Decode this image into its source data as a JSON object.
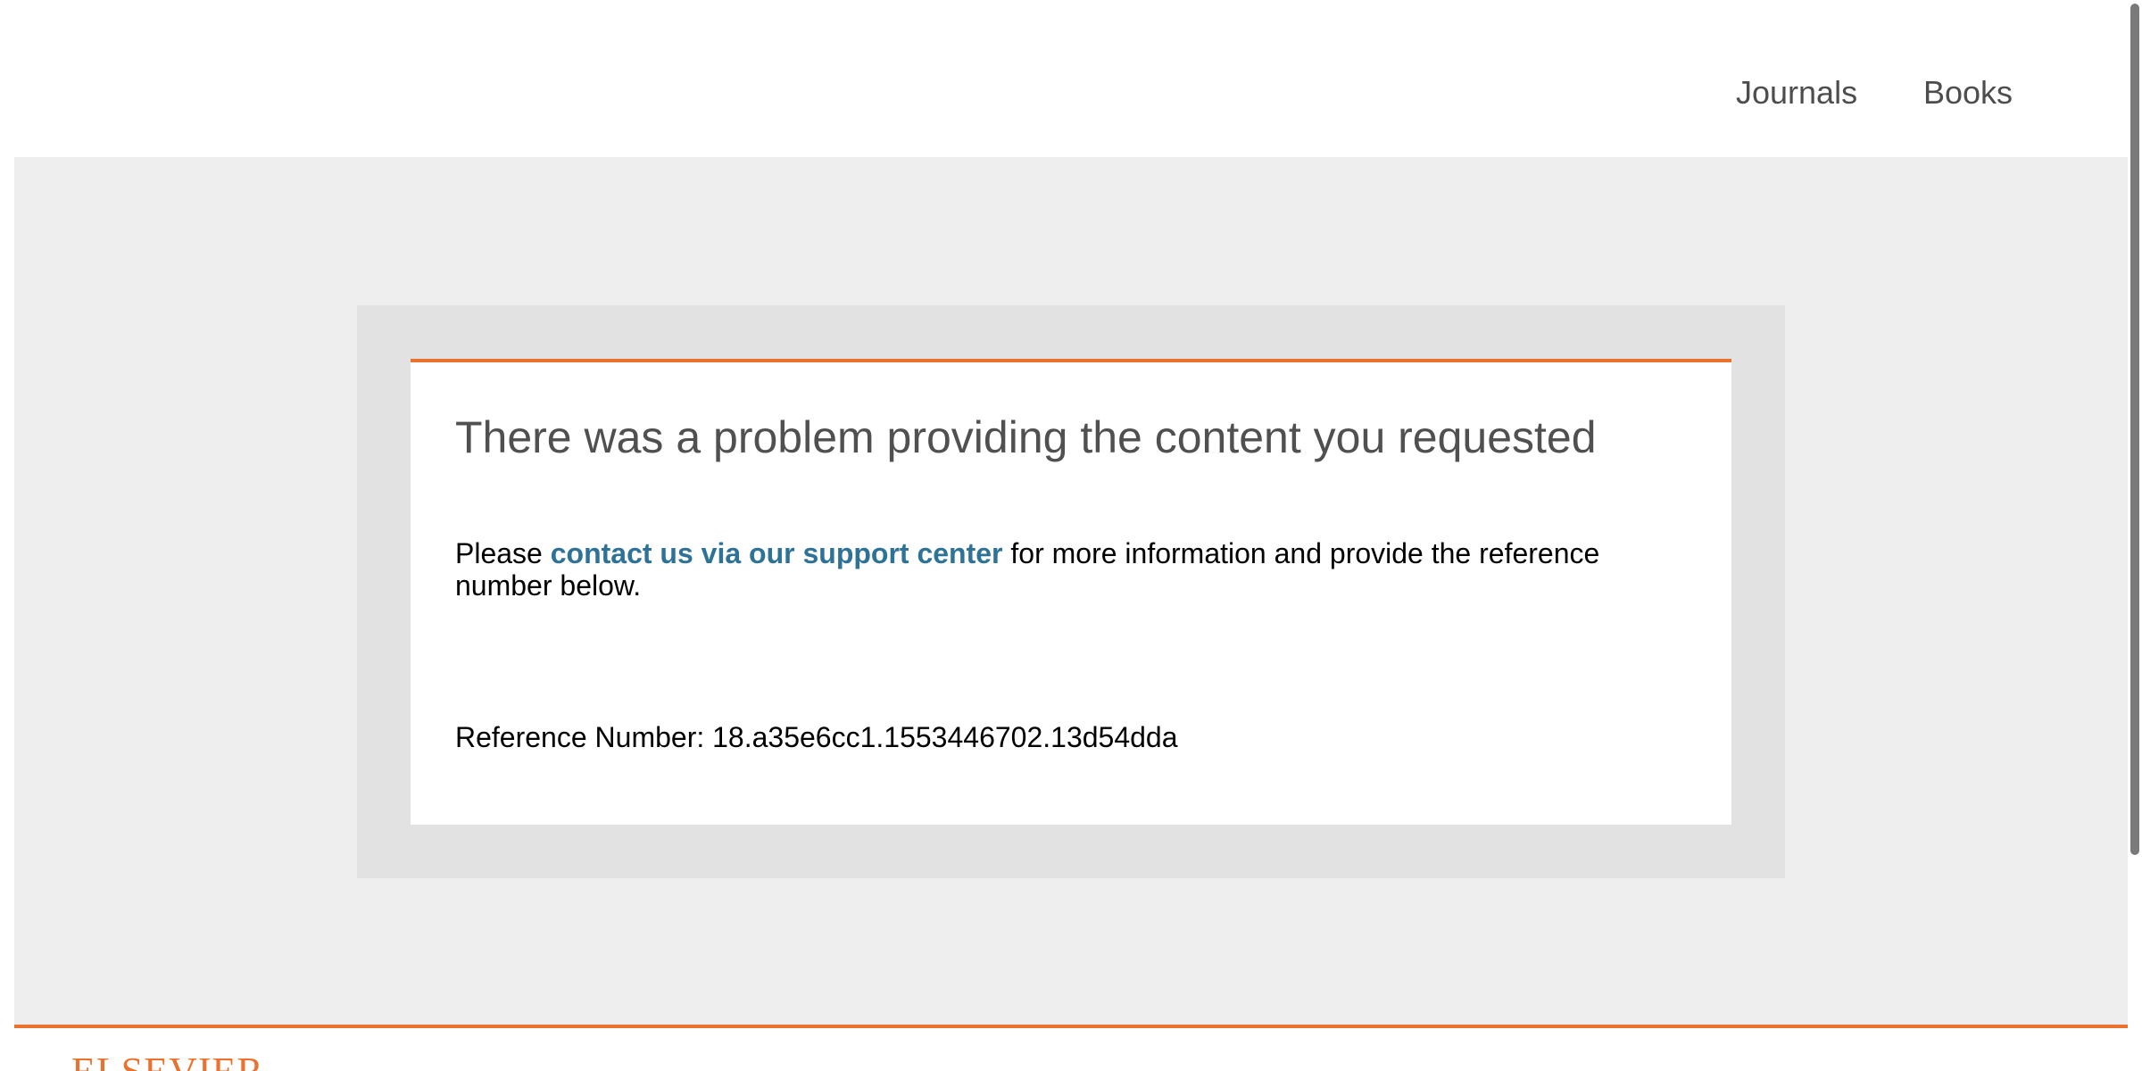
{
  "nav": {
    "journals": "Journals",
    "books": "Books"
  },
  "error": {
    "title": "There was a problem providing the content you requested",
    "message_prefix": "Please ",
    "support_link": "contact us via our support center",
    "message_suffix": " for more information and provide the reference number below.",
    "reference_label": "Reference Number: ",
    "reference_value": "18.a35e6cc1.1553446702.13d54dda"
  },
  "footer": {
    "logo_text": "ELSEVIER"
  },
  "colors": {
    "accent": "#e9722e",
    "link": "#2e7397",
    "band": "#eeeeee",
    "frame": "#e2e2e2",
    "title": "#505050"
  }
}
